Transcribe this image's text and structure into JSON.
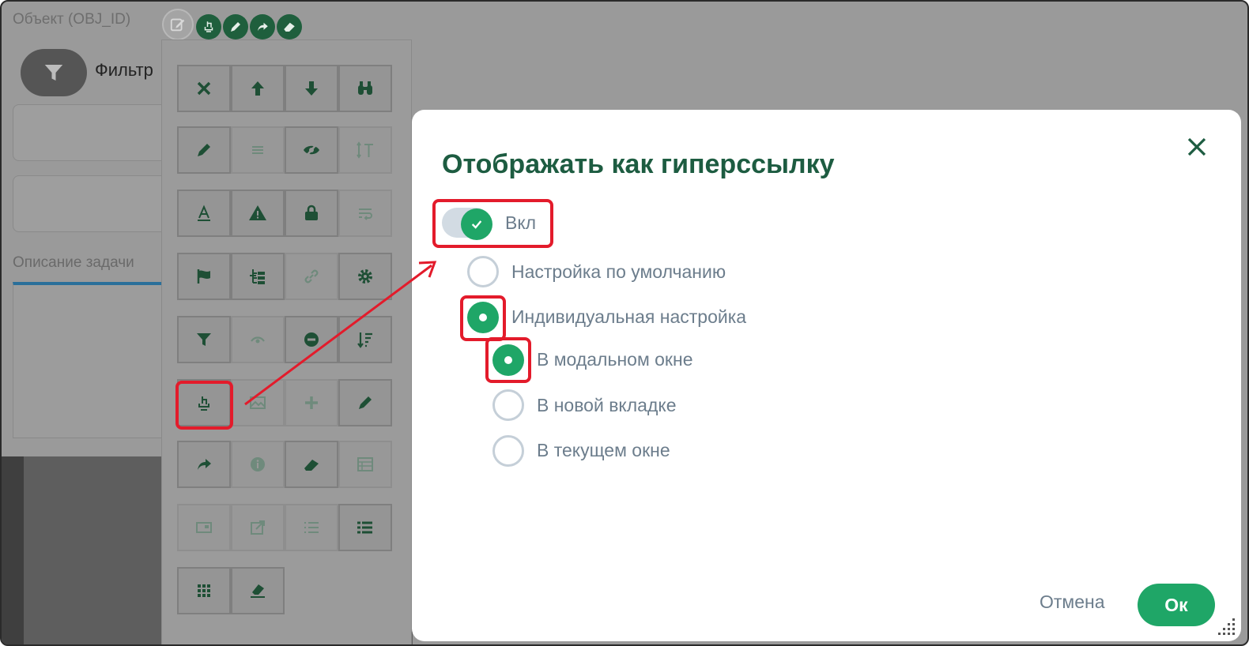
{
  "background": {
    "object_title": "Объект (OBJ_ID)",
    "filter_label": "Фильтр",
    "description_label": "Описание задачи"
  },
  "modal": {
    "title": "Отображать как гиперссылку",
    "toggle_label": "Вкл",
    "options": {
      "default": "Настройка по умолчанию",
      "individual": "Индивидуальная настройка",
      "modal_window": "В модальном окне",
      "new_tab": "В новой вкладке",
      "current_window": "В текущем окне"
    },
    "cancel_label": "Отмена",
    "ok_label": "Ок"
  },
  "colors": {
    "accent": "#1fa667",
    "title": "#1d5c41",
    "annotation": "#e31b2b"
  }
}
